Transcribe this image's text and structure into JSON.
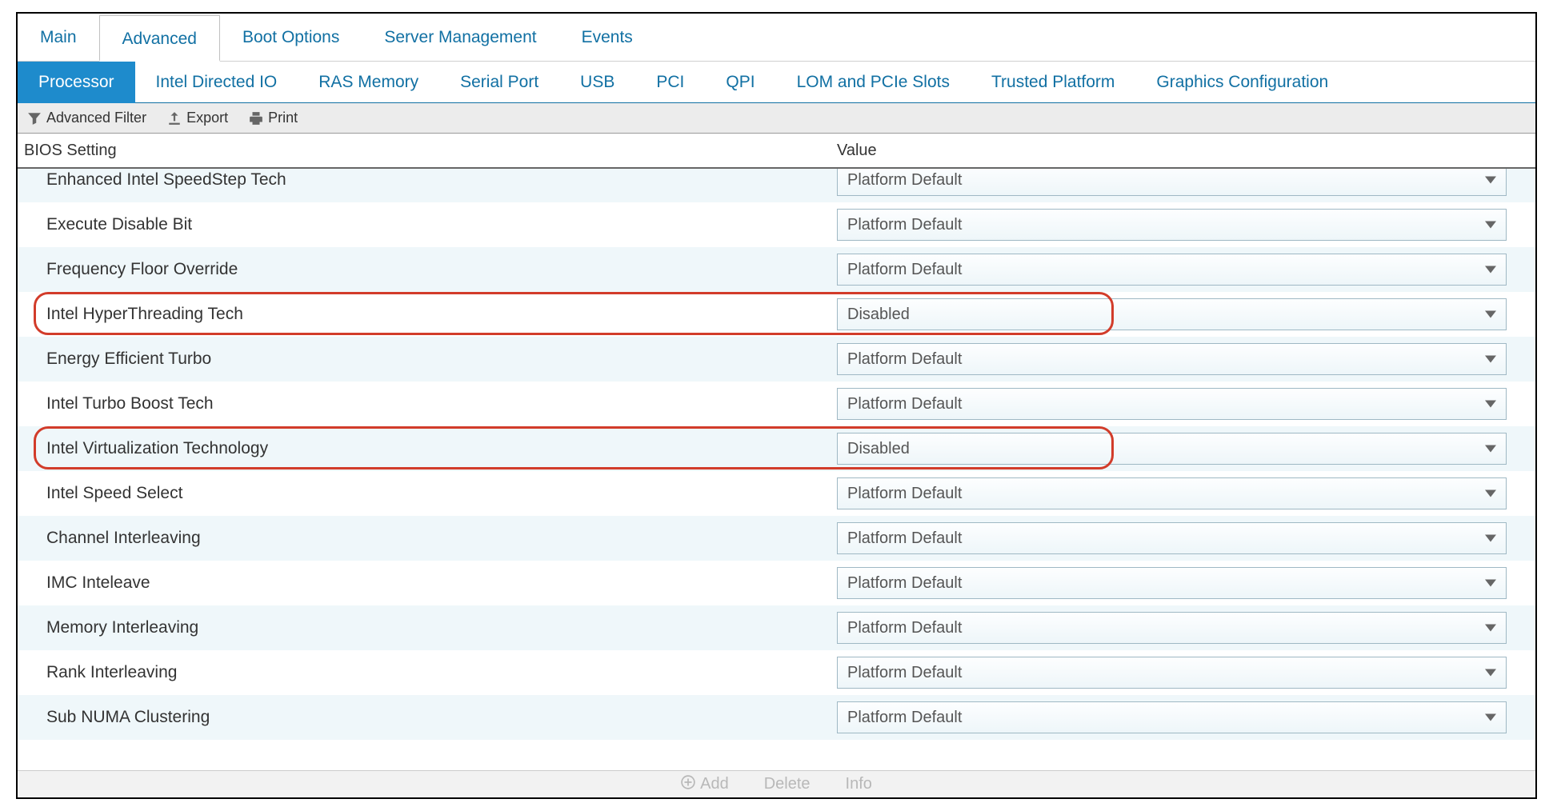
{
  "primary_tabs": [
    {
      "label": "Main",
      "active": false
    },
    {
      "label": "Advanced",
      "active": true
    },
    {
      "label": "Boot Options",
      "active": false
    },
    {
      "label": "Server Management",
      "active": false
    },
    {
      "label": "Events",
      "active": false
    }
  ],
  "secondary_tabs": [
    {
      "label": "Processor",
      "active": true
    },
    {
      "label": "Intel Directed IO",
      "active": false
    },
    {
      "label": "RAS Memory",
      "active": false
    },
    {
      "label": "Serial Port",
      "active": false
    },
    {
      "label": "USB",
      "active": false
    },
    {
      "label": "PCI",
      "active": false
    },
    {
      "label": "QPI",
      "active": false
    },
    {
      "label": "LOM and PCIe Slots",
      "active": false
    },
    {
      "label": "Trusted Platform",
      "active": false
    },
    {
      "label": "Graphics Configuration",
      "active": false
    }
  ],
  "toolbar": {
    "filter": "Advanced Filter",
    "export": "Export",
    "print": "Print"
  },
  "columns": {
    "setting": "BIOS Setting",
    "value": "Value"
  },
  "rows": [
    {
      "label": "Enhanced Intel SpeedStep Tech",
      "value": "Platform Default",
      "highlight": false,
      "alt": true
    },
    {
      "label": "Execute Disable Bit",
      "value": "Platform Default",
      "highlight": false,
      "alt": false
    },
    {
      "label": "Frequency Floor Override",
      "value": "Platform Default",
      "highlight": false,
      "alt": true
    },
    {
      "label": "Intel HyperThreading Tech",
      "value": "Disabled",
      "highlight": true,
      "alt": false
    },
    {
      "label": "Energy Efficient Turbo",
      "value": "Platform Default",
      "highlight": false,
      "alt": true
    },
    {
      "label": "Intel Turbo Boost Tech",
      "value": "Platform Default",
      "highlight": false,
      "alt": false
    },
    {
      "label": "Intel Virtualization Technology",
      "value": "Disabled",
      "highlight": true,
      "alt": true
    },
    {
      "label": "Intel Speed Select",
      "value": "Platform Default",
      "highlight": false,
      "alt": false
    },
    {
      "label": "Channel Interleaving",
      "value": "Platform Default",
      "highlight": false,
      "alt": true
    },
    {
      "label": "IMC Inteleave",
      "value": "Platform Default",
      "highlight": false,
      "alt": false
    },
    {
      "label": "Memory Interleaving",
      "value": "Platform Default",
      "highlight": false,
      "alt": true
    },
    {
      "label": "Rank Interleaving",
      "value": "Platform Default",
      "highlight": false,
      "alt": false
    },
    {
      "label": "Sub NUMA Clustering",
      "value": "Platform Default",
      "highlight": false,
      "alt": true
    }
  ],
  "footer": {
    "add": "Add",
    "delete": "Delete",
    "info": "Info"
  }
}
